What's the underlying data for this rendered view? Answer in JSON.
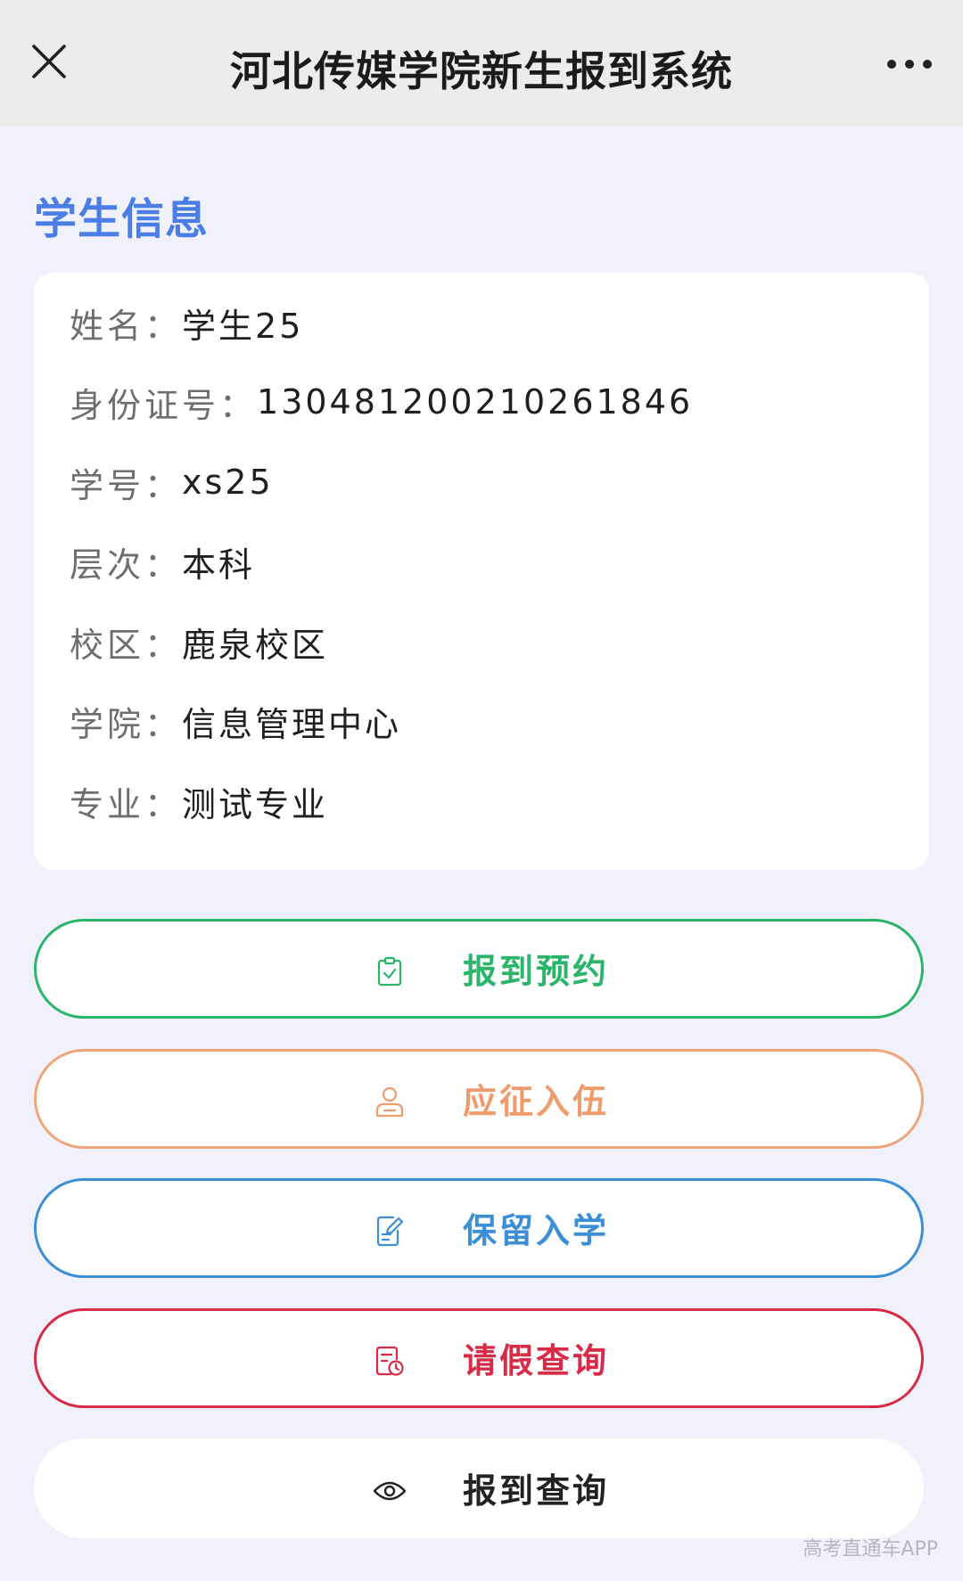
{
  "header": {
    "title": "河北传媒学院新生报到系统",
    "close_icon": "close-icon",
    "more_icon": "more-dots-icon"
  },
  "section": {
    "title": "学生信息"
  },
  "student_info": [
    {
      "label": "姓名：",
      "value": "学生25"
    },
    {
      "label": "身份证号：",
      "value": "130481200210261846"
    },
    {
      "label": "学号：",
      "value": "xs25"
    },
    {
      "label": "层次：",
      "value": "本科"
    },
    {
      "label": "校区：",
      "value": "鹿泉校区"
    },
    {
      "label": "学院：",
      "value": "信息管理中心"
    },
    {
      "label": "专业：",
      "value": "测试专业"
    }
  ],
  "actions": [
    {
      "label": "报到预约",
      "icon": "clipboard-check-icon",
      "color": "#2bb56a",
      "border": "#2bb56a"
    },
    {
      "label": "应征入伍",
      "icon": "person-icon",
      "color": "#ef9c6c",
      "border": "#efa57a"
    },
    {
      "label": "保留入学",
      "icon": "document-edit-icon",
      "color": "#3c8fd6",
      "border": "#3c8fd6"
    },
    {
      "label": "请假查询",
      "icon": "document-clock-icon",
      "color": "#d72b48",
      "border": "#d72b48"
    },
    {
      "label": "报到查询",
      "icon": "eye-icon",
      "color": "#222222",
      "border": "#ffffff"
    }
  ],
  "watermark": "高考直通车APP",
  "colors": {
    "accent_blue": "#4a7ee6",
    "background": "#f1f1fb",
    "topbar": "#ececec"
  }
}
